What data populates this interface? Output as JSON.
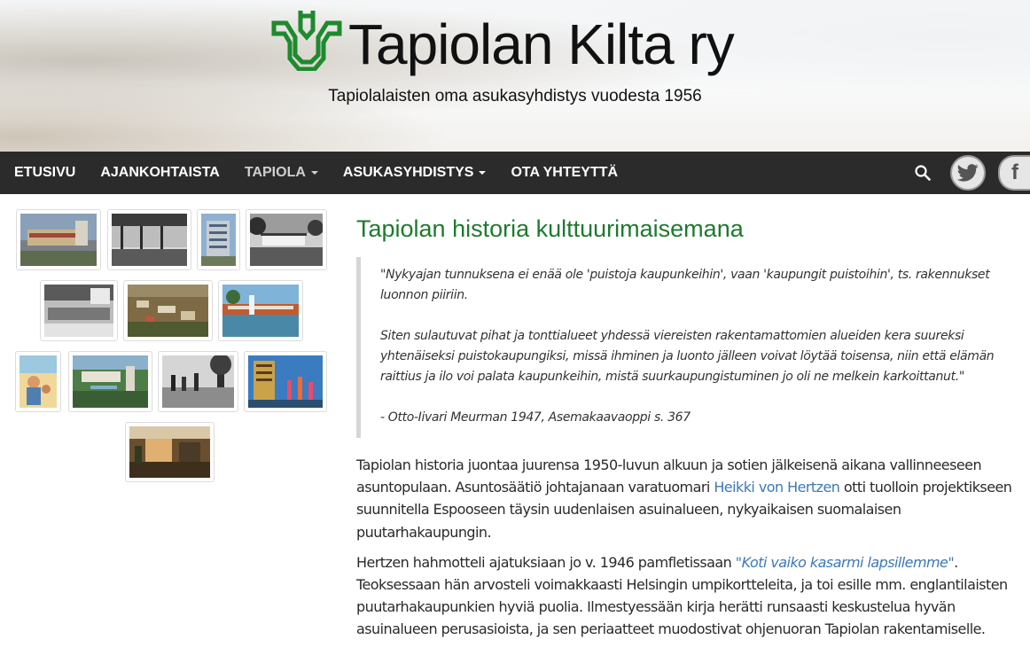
{
  "header": {
    "site_title": "Tapiolan Kilta ry",
    "tagline": "Tapiolalaisten oma asukasyhdistys vuodesta 1956",
    "logo_color": "#1d8a2e"
  },
  "nav": {
    "items": [
      {
        "label": "ETUSIVU",
        "dropdown": false
      },
      {
        "label": "AJANKOHTAISTA",
        "dropdown": false
      },
      {
        "label": "TAPIOLA",
        "dropdown": true
      },
      {
        "label": "ASUKASYHDISTYS",
        "dropdown": true
      },
      {
        "label": "OTA YHTEYTTÄ",
        "dropdown": false
      }
    ],
    "icons": [
      "search-icon",
      "twitter-icon",
      "facebook-icon"
    ],
    "facebook_glyph": "f",
    "background": "#2b2b2b"
  },
  "gallery": {
    "thumb_count": 12
  },
  "article": {
    "title": "Tapiolan historia kulttuurimaisemana",
    "title_color": "#1e7a2e",
    "quote": [
      "\"Nykyajan tunnuksena ei enää ole 'puistoja kaupunkeihin', vaan 'kaupungit puistoihin', ts. rakennukset luonnon piiriin.",
      "Siten sulautuvat pihat ja tonttialueet yhdessä viereisten rakentamattomien alueiden kera suureksi yhtenäiseksi puistokaupungiksi, missä ihminen ja luonto jälleen voivat löytää toisensa, niin että elämän raittius ja ilo voi palata kaupunkeihin, mistä suurkaupungistuminen jo oli ne melkein karkoittanut.\"",
      "- Otto-Iivari Meurman 1947, Asemakaavaoppi s. 367"
    ],
    "para1": {
      "before": "Tapiolan historia juontaa juurensa 1950-luvun alkuun ja sotien jälkeisenä aikana vallinneeseen asuntopulaan. Asuntosäätiö johtajanaan varatuomari ",
      "link": "Heikki von Hertzen",
      "after": " otti tuolloin projektikseen suunnitella Espooseen täysin uudenlaisen asuinalueen, nykyaikaisen suomalaisen puutarhakaupungin."
    },
    "para2": {
      "before": "Hertzen hahmotteli ajatuksiaan jo v. 1946 pamfletissaan ",
      "link": "\"Koti vaiko kasarmi lapsillemme\"",
      "after": ". Teoksessaan hän arvosteli voimakkaasti Helsingin umpikortteleita, ja toi esille mm. englantilaisten puutarhakaupunkien hyviä puolia. Ilmestyessään kirja herätti runsaasti keskustelua hyvän asuinalueen perusasioista, ja sen periaatteet muodostivat ohjenuoran Tapiolan rakentamiselle."
    },
    "link_color": "#3d78b5"
  }
}
